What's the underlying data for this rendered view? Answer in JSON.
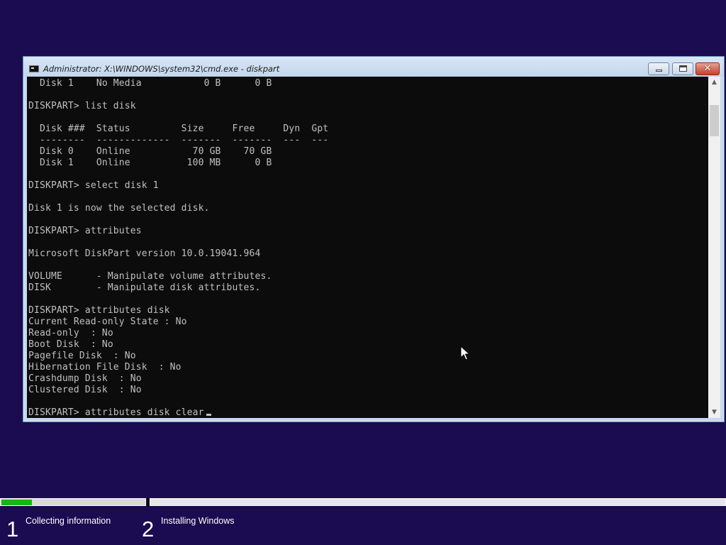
{
  "window": {
    "title": "Administrator: X:\\WINDOWS\\system32\\cmd.exe - diskpart"
  },
  "console": {
    "lines": [
      "  Disk 1    No Media           0 B      0 B",
      "",
      "DISKPART> list disk",
      "",
      "  Disk ###  Status         Size     Free     Dyn  Gpt",
      "  --------  -------------  -------  -------  ---  ---",
      "  Disk 0    Online           70 GB    70 GB",
      "  Disk 1    Online          100 MB      0 B",
      "",
      "DISKPART> select disk 1",
      "",
      "Disk 1 is now the selected disk.",
      "",
      "DISKPART> attributes",
      "",
      "Microsoft DiskPart version 10.0.19041.964",
      "",
      "VOLUME      - Manipulate volume attributes.",
      "DISK        - Manipulate disk attributes.",
      "",
      "DISKPART> attributes disk",
      "Current Read-only State : No",
      "Read-only  : No",
      "Boot Disk  : No",
      "Pagefile Disk  : No",
      "Hibernation File Disk  : No",
      "Crashdump Disk  : No",
      "Clustered Disk  : No",
      "",
      "DISKPART> attributes disk clear"
    ]
  },
  "setup": {
    "progress_fraction": 0.21,
    "colors": {
      "background": "#1b0b50",
      "progress_fill": "#14b814"
    },
    "steps": [
      {
        "number": "1",
        "label": "Collecting information"
      },
      {
        "number": "2",
        "label": "Installing Windows"
      }
    ]
  }
}
